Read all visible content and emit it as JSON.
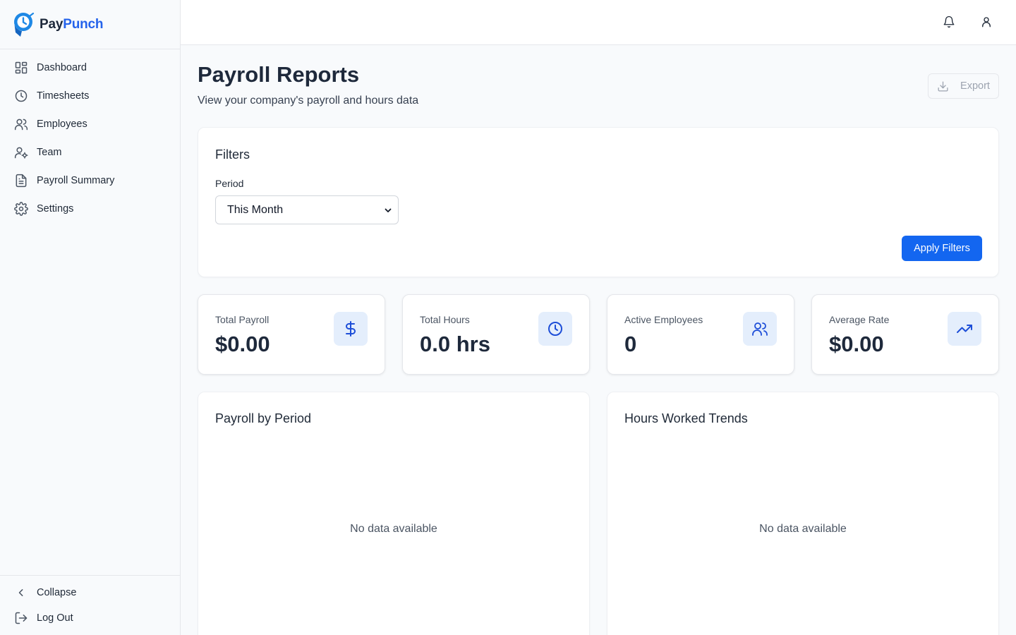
{
  "brand": {
    "name_prefix": "Pay",
    "name_accent": "Punch",
    "accent_color": "#2563eb"
  },
  "sidebar": {
    "items": [
      {
        "label": "Dashboard",
        "icon": "dashboard-icon"
      },
      {
        "label": "Timesheets",
        "icon": "clock-icon"
      },
      {
        "label": "Employees",
        "icon": "users-icon"
      },
      {
        "label": "Team",
        "icon": "user-cog-icon"
      },
      {
        "label": "Payroll Summary",
        "icon": "document-icon"
      },
      {
        "label": "Settings",
        "icon": "gear-icon"
      }
    ],
    "bottom": [
      {
        "label": "Collapse",
        "icon": "chevron-left-icon"
      },
      {
        "label": "Log Out",
        "icon": "logout-icon"
      }
    ]
  },
  "topbar": {
    "icons": [
      "bell-icon",
      "user-icon"
    ]
  },
  "header": {
    "title": "Payroll Reports",
    "subtitle": "View your company's payroll and hours data",
    "export_label": "Export"
  },
  "filters": {
    "title": "Filters",
    "period_label": "Period",
    "period_value": "This Month",
    "apply_label": "Apply Filters"
  },
  "stats": [
    {
      "label": "Total Payroll",
      "value": "$0.00",
      "icon": "dollar-icon"
    },
    {
      "label": "Total Hours",
      "value": "0.0 hrs",
      "icon": "clock-icon"
    },
    {
      "label": "Active Employees",
      "value": "0",
      "icon": "users-icon"
    },
    {
      "label": "Average Rate",
      "value": "$0.00",
      "icon": "trending-up-icon"
    }
  ],
  "charts": [
    {
      "title": "Payroll by Period",
      "empty_text": "No data available"
    },
    {
      "title": "Hours Worked Trends",
      "empty_text": "No data available"
    }
  ],
  "colors": {
    "primary": "#1366f0",
    "stat_icon_bg": "#e4eefc"
  }
}
